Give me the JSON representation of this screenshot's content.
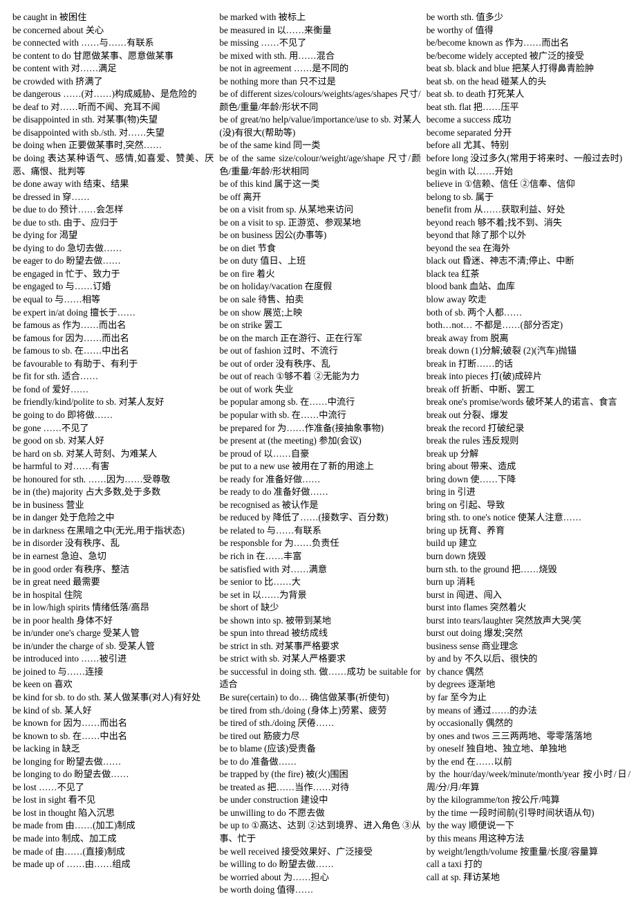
{
  "document": {
    "type": "english-chinese-phrase-list",
    "columns": [
      {
        "id": "column-1",
        "entries": [
          "be caught in  被困住",
          "be concerned about   关心",
          "be connected with  ……与……有联系",
          "be content to do   甘愿做某事、愿意做某事",
          "be content with   对……满足",
          "be crowded with   挤满了",
          "be dangerous  ……(对……)构成威胁、是危险的",
          "be deaf to   对……听而不闻、充耳不闻",
          "be disappointed in sth.   对某事(物)失望",
          "be disappointed with sb./sth.   对……失望",
          "be doing when   正要做某事时,突然……",
          "be doing   表达某种语气、感情,如喜爱、赞美、厌恶、痛恨、批判等",
          "be done away with   结束、结果",
          "be dressed in  穿……",
          "be due to do  预计……会怎样",
          "be due to sth. 由于、应归于",
          "be dying for  渴望",
          "be dying to do  急切去做……",
          "be eager to do  盼望去做……",
          "be engaged in   忙于、致力于",
          "be engaged to   与……订婚",
          "be equal to  与……相等",
          "be expert in/at doing  擅长于……",
          "be famous as  作为……而出名",
          "be famous for   因为……而出名",
          "be famous to sb.   在……中出名",
          "be favourable to   有助于、有利于",
          "be fit for sth. 适合……",
          "be fond of   爱好……",
          "be friendly/kind/polite to sb.   对某人友好",
          "be going to do   即将做……",
          "be gone  ……不见了",
          "be good on sb.   对某人好",
          "be hard on sb.   对某人苛刻、为难某人",
          "be harmful to   对……有害",
          "be honoured for sth.  ……因为……受尊敬",
          "be in (the) majority   占大多数,处于多数",
          "be in business   营业",
          "be in danger  处于危险之中",
          "be in darkness   在黑暗之中(无光,用于指状态)",
          "be in disorder   没有秩序、乱",
          "be in earnest  急迫、急切",
          "be in good order   有秩序、整洁",
          "be in great need   最需要",
          "be in hospital   住院",
          "be in low/high spirits   情绪低落/高昂",
          "be in poor health   身体不好",
          "be in/under one's charge   受某人管",
          "be in/under the charge of sb. 受某人管",
          "be introduced into  ……被引进",
          "be joined to  与……连接",
          "be keen on   喜欢",
          "be kind for sb. to do sth. 某人做某事(对人)有好处",
          "be kind of sb.   某人好",
          "be known for  因为……而出名",
          "be known to sb.   在……中出名",
          "be lacking in  缺乏",
          "be longing for   盼望去做……",
          "be longing to do   盼望去做……",
          "be lost  ……不见了",
          "be lost in sight  看不见",
          "be lost in thought   陷入沉思",
          "be made from   由……(加工)制成",
          "be made into  制成、加工成",
          "be made of  由……(直接)制成",
          "be made up of  ……由……组成"
        ]
      },
      {
        "id": "column-2",
        "entries": [
          "be marked with   被标上",
          "be measured in   以……来衡量",
          "be missing  ……不见了",
          "be mixed with sth.   用……混合",
          "be not in agreement  ……是不同的",
          "be nothing more than   只不过是",
          "be of different sizes/colours/weights/ages/shapes   尺寸/颜色/重量/年龄/形状不同",
          "be of great/no help/value/importance/use to sb. 对某人(没)有很大(帮助等)",
          "be of the same kind  同一类",
          "be of the same size/colour/weight/age/shape 尺寸/颜色/重量/年龄/形状相同",
          "be of this kind   属于这一类",
          "be off   离开",
          "be on a visit from sp.   从某地来访问",
          "be on a visit to sp.   正游览、参观某地",
          "be on business   因公(办事等)",
          "be on diet   节食",
          "be on duty   值日、上班",
          "be on fire   着火",
          "be on holiday/vacation  在度假",
          "be on sale   待售、拍卖",
          "be on show  展览;上映",
          "be on strike  罢工",
          "be on the march   正在游行、正在行军",
          "be out of fashion   过时、不流行",
          "be out of order   没有秩序、乱",
          "be out of reach   ①够不着 ②无能为力",
          "be out of work   失业",
          "be popular among sb.   在……中流行",
          "be popular with sb.   在……中流行",
          "be prepared for   为……作准备(接抽象事物)",
          "be present at (the meeting)  参加(会议)",
          "be proud of  以……自豪",
          "be put to a new use   被用在了新的用途上",
          "be ready for  准备好做……",
          "be ready to do  准备好做……",
          "be recognised as   被认作是",
          "be reduced by   降低了……(接数字、百分数)",
          "be related to  与……有联系",
          "be responsble for   为……负责任",
          "be rich in   在……丰富",
          "be satisfied with   对……满意",
          "be senior to  比……大",
          "be set in   以……为背景",
          "be short of   缺少",
          "be shown into sp.   被带到某地",
          "be spun into thread  被纺成线",
          "be strict in sth.   对某事严格要求",
          "be strict with sb.   对某人严格要求",
          "be successful in doing sth. 做……成功    be suitable for   适合",
          "Be sure(certain) to do…   确信做某事(祈使句)",
          "be tired from sth./doing (身体上)劳累、疲劳",
          "be tired of sth./doing   厌倦……",
          "be tired out  筋疲力尽",
          "be to blame (应该)受责备",
          "be to do   准备做……",
          "be trapped by (the fire)   被(火)围困",
          "be treated as  把……当作……对待",
          "be under construction   建设中",
          "be unwilling to do   不愿去做",
          "be up to   ①高达、达到   ②达到境界、进入角色   ③从事、忙于",
          "be well received  接受效果好、广泛接受",
          "be willing to do   盼望去做……",
          "be worried about   为……担心",
          "be worth doing  值得……"
        ]
      },
      {
        "id": "column-3",
        "entries": [
          "be worth sth. 值多少",
          "be worthy of  值得",
          "be/become known as   作为……而出名",
          "be/become widely accepted  被广泛的接受",
          "beat sb. black and blue   把某人打得鼻青脸肿",
          "beat sb. on the head   碰某人的头",
          "beat sb. to death   打死某人",
          "beat sth. flat   把……压平",
          "become a success   成功",
          "become separated   分开",
          "before all  尤其、特别",
          "before long   没过多久(常用于将来时、一般过去时)",
          "begin with   以……开始",
          "believe in   ①信赖、信任 ②信奉、信仰",
          "belong to sb. 属于",
          "benefit from   从……获取利益、好处",
          "beyond reach   够不着;找不到、消失",
          "beyond that  除了那个以外",
          "beyond the sea   在海外",
          "black out   昏迷、神志不清;停止、中断",
          "black tea   红茶",
          "blood bank  血站、血库",
          "blow away  吹走",
          "both of sb.   两个人都……",
          "both…not…  不都是……(部分否定)",
          "break away from   脱离",
          "break down (1)分解;破裂 (2)(汽车)抛锚",
          "break in   打断……的话",
          "break into pieces  打(破)成碎片",
          "break off   折断、中断、罢工",
          "break one's promise/words  破坏某人的诺言、食言",
          "break out   分裂、爆发",
          "break the record  打破纪录",
          "break the rules  违反规则",
          "break up   分解",
          "bring about  带来、造成",
          "bring down  使……下降",
          "bring in   引进",
          "bring on   引起、导致",
          "bring sth. to one's notice   使某人注意……",
          "bring up   抚育、养育",
          "build up   建立",
          "burn down   烧毁",
          "burn sth. to the ground   把……烧毁",
          "burn up   消耗",
          "burst in   闯进、闯入",
          "burst into flames   突然着火",
          "burst into tears/laughter   突然放声大哭/笑",
          "burst out doing   爆发;突然",
          "business sense   商业理念",
          "by and by   不久以后、很快的",
          "by chance  偶然",
          "by degrees   逐渐地",
          "by far   至今为止",
          "by means of  通过……的办法",
          "by occasionally   偶然的",
          "by ones and twos   三三两两地、零零落落地",
          "by oneself   独自地、独立地、单独地",
          "by the end   在……以前",
          "by the hour/day/week/minute/month/year   按小时/日/周/分/月/年算",
          "by the kilogramme/ton   按公斤/吨算",
          "by the time   一段时间前(引导时间状语从句)",
          "by the way  顺便说一下",
          "by this means   用这种方法",
          "by weight/length/volume   按重量/长度/容量算",
          "call a taxi   打的",
          "call at sp.  拜访某地"
        ]
      }
    ]
  }
}
